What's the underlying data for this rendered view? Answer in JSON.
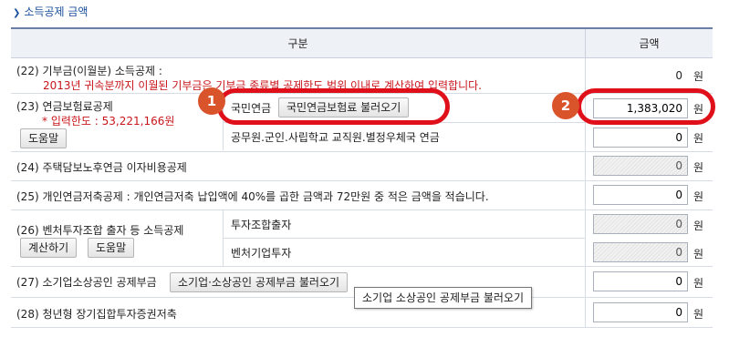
{
  "section_title": "소득공제 금액",
  "header": {
    "col_category": "구분",
    "col_amount": "금액"
  },
  "unit": "원",
  "rows": {
    "r22": {
      "label": "(22) 기부금(이월분) 소득공제 :",
      "note": "2013년 귀속분까지 이월된 기부금은 기부금 종류별 공제한도 범위 이내로 계산하여 입력합니다.",
      "amount": "0"
    },
    "r23": {
      "label": "(23) 연금보험료공제",
      "limit": "* 입력한도 : 53,221,166원",
      "help_btn": "도움말",
      "sub1_label": "국민연금",
      "sub1_btn": "국민연금보험료 불러오기",
      "sub1_amount": "1,383,020",
      "sub2_label": "공무원.군인.사립학교 교직원.별정우체국 연금",
      "sub2_amount": "0"
    },
    "r24": {
      "label": "(24) 주택담보노후연금 이자비용공제",
      "amount": "0"
    },
    "r25": {
      "label": "(25) 개인연금저축공제 : 개인연금저축 납입액에 40%를 곱한 금액과 72만원 중 적은 금액을 적습니다.",
      "amount": "0"
    },
    "r26": {
      "label": "(26) 벤처투자조합 출자 등 소득공제",
      "calc_btn": "계산하기",
      "help_btn": "도움말",
      "sub1_label": "투자조합출자",
      "sub1_amount": "0",
      "sub2_label": "벤처기업투자",
      "sub2_amount": "0"
    },
    "r27": {
      "label": "(27) 소기업소상공인 공제부금",
      "btn": "소기업·소상공인 공제부금 불러오기",
      "amount": "0"
    },
    "r28": {
      "label": "(28) 청년형 장기집합투자증권저축",
      "amount": "0"
    }
  },
  "tooltip": "소기업 소상공인 공제부금 불러오기",
  "callouts": {
    "badge1": "1",
    "badge2": "2"
  }
}
